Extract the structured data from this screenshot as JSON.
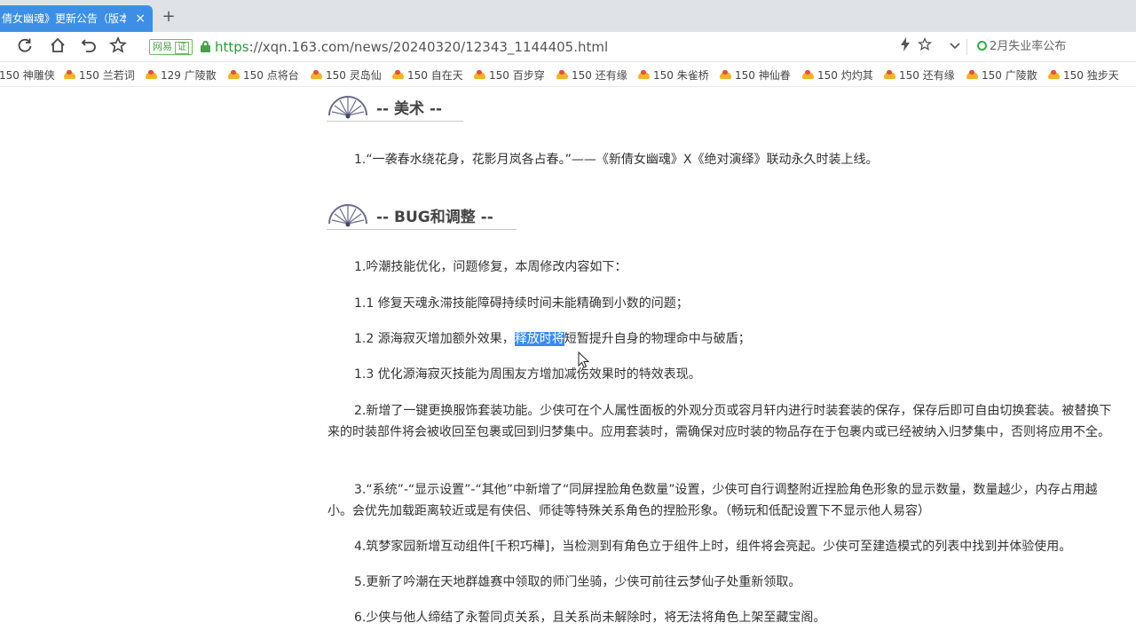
{
  "browser": {
    "tab": {
      "title": "倩女幽魂》更新公告（版本",
      "close": "×"
    },
    "new_tab": "+",
    "address": {
      "badge_label": "网易",
      "badge_cert": "证",
      "url_scheme": "https",
      "url_rest": "://xqn.163.com/news/20240320/12343_1144405.html"
    },
    "search": {
      "text": "2月失业率公布"
    }
  },
  "bookmarks": [
    {
      "label": "150 神雕侠"
    },
    {
      "label": "150 兰若词"
    },
    {
      "label": "129 广陵散"
    },
    {
      "label": "150 点将台"
    },
    {
      "label": "150 灵岛仙"
    },
    {
      "label": "150 自在天"
    },
    {
      "label": "150 百步穿"
    },
    {
      "label": "150 还有缘"
    },
    {
      "label": "150 朱雀桥"
    },
    {
      "label": "150 神仙眷"
    },
    {
      "label": "150 灼灼其"
    },
    {
      "label": "150 还有缘"
    },
    {
      "label": "150 广陵散"
    },
    {
      "label": "150 独步天"
    }
  ],
  "article": {
    "art_heading": "-- 美术 --",
    "art_items": [
      "1.“一袭春水绕花身，花影月岚各占春。”——《新倩女幽魂》X《绝对演绎》联动永久时装上线。"
    ],
    "bug_heading": "-- BUG和调整 --",
    "p1": "1.吟潮技能优化，问题修复，本周修改内容如下：",
    "p1_1": "1.1 修复天魂永滞技能障碍持续时间未能精确到小数的问题；",
    "p1_2_before": "1.2 源海寂灭增加额外效果，",
    "p1_2_highlight": "释放时将",
    "p1_2_after": "短暂提升自身的物理命中与破盾；",
    "p1_3": "1.3 优化源海寂灭技能为周围友方增加减伤效果时的特效表现。",
    "p2": "2.新增了一键更换服饰套装功能。少侠可在个人属性面板的外观分页或容月轩内进行时装套装的保存，保存后即可自由切换套装。被替换下来的时装部件将会被收回至包裹或回到归梦集中。应用套装时，需确保对应时装的物品存在于包裹内或已经被纳入归梦集中，否则将应用不全。",
    "p3": "3.“系统”-“显示设置”-“其他”中新增了“同屏捏脸角色数量”设置，少侠可自行调整附近捏脸角色形象的显示数量，数量越少，内存占用越小。会优先加载距离较近或是有侠侣、师徒等特殊关系角色的捏脸形象。（畅玩和低配设置下不显示他人易容）",
    "p4": "4.筑梦家园新增互动组件[千积巧樺]，当检测到有角色立于组件上时，组件将会亮起。少侠可至建造模式的列表中找到并体验使用。",
    "p5": "5.更新了吟潮在天地群雄赛中领取的师门坐骑，少侠可前往云梦仙子处重新领取。",
    "p6": "6.少侠与他人缔结了永誓同贞关系，且关系尚未解除时，将无法将角色上架至藏宝阁。"
  }
}
